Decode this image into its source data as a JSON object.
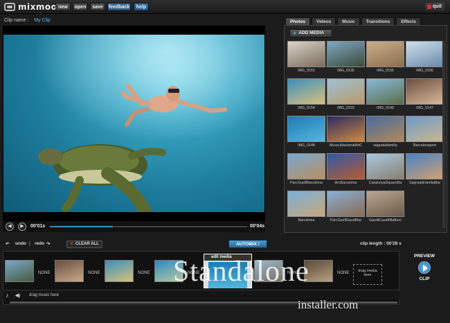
{
  "app": {
    "logo_text": "mixmoov"
  },
  "menu": {
    "new": "new",
    "open": "open",
    "save": "save",
    "feedback": "feedback",
    "help": "help",
    "quit": "quit"
  },
  "clip": {
    "label": "Clip name :",
    "name": "My Clip"
  },
  "player": {
    "current_time": "00'01s",
    "total_time": "00'04s",
    "progress": 0.32
  },
  "media_tabs": [
    "Photos",
    "Videos",
    "Music",
    "Transitions",
    "Effects"
  ],
  "add_media_label": "ADD MEDIA",
  "media": [
    {
      "label": "IMG_0151",
      "colors": [
        "#d9d3c8",
        "#7a6c5a"
      ]
    },
    {
      "label": "IMG_0135",
      "colors": [
        "#7fa7c4",
        "#3d4a3a"
      ]
    },
    {
      "label": "IMG_0155",
      "colors": [
        "#c9b08a",
        "#8a6d4e"
      ]
    },
    {
      "label": "IMG_0156",
      "colors": [
        "#cde0ee",
        "#6a8aa6"
      ]
    },
    {
      "label": "IMG_0154",
      "colors": [
        "#3a8fbf",
        "#d8c07a"
      ]
    },
    {
      "label": "IMG_0153",
      "colors": [
        "#9fc0d4",
        "#b89a6c"
      ]
    },
    {
      "label": "IMG_0149",
      "colors": [
        "#8ab8dc",
        "#5a6e48"
      ]
    },
    {
      "label": "IMG_0147",
      "colors": [
        "#6a5040",
        "#d9b898"
      ]
    },
    {
      "label": "IMG_0148",
      "colors": [
        "#1f7ab0",
        "#52b8e0"
      ]
    },
    {
      "label": "MuseuNacionalArtC",
      "colors": [
        "#2a2a60",
        "#d08a40"
      ]
    },
    {
      "label": "sagradafamilia",
      "colors": [
        "#4a6aa0",
        "#b08a5a"
      ]
    },
    {
      "label": "Barcelonaport",
      "colors": [
        "#6f9ac8",
        "#c8b890"
      ]
    },
    {
      "label": "ParcGuellBarcelona",
      "colors": [
        "#78a8d0",
        "#b89060"
      ]
    },
    {
      "label": "ArcBarcelona",
      "colors": [
        "#2d5aa8",
        "#b85a30"
      ]
    },
    {
      "label": "CatalunyaSquareBa",
      "colors": [
        "#a8c8e0",
        "#8a8070"
      ]
    },
    {
      "label": "SagradaFamiliaBar",
      "colors": [
        "#4a82c8",
        "#d0a070"
      ]
    },
    {
      "label": "Barcelona",
      "colors": [
        "#7ab0d8",
        "#c8a878"
      ]
    },
    {
      "label": "ParcGuellGaudiBar",
      "colors": [
        "#88b0d8",
        "#8a6a50"
      ]
    },
    {
      "label": "GaudiCasaMilaBarc",
      "colors": [
        "#b8a890",
        "#6a5a48"
      ]
    }
  ],
  "timeline": {
    "undo": "undo",
    "redo": "redo",
    "clear_all": "CLEAR ALL",
    "automix": "AUTOMIX !",
    "clip_length": "clip length : 00'28 s",
    "none_label": "NONE",
    "edit_media": "edit media",
    "drag_media": "drag media here",
    "drag_music": "drag music here",
    "clips": [
      {
        "colors": [
          "#7aa8c8",
          "#4a5a40"
        ]
      },
      {
        "colors": [
          "#6a5040",
          "#c8a888"
        ]
      },
      {
        "colors": [
          "#3a8fbf",
          "#d8c07a"
        ]
      },
      {
        "colors": [
          "#2a8ac0",
          "#b8c8a0"
        ]
      },
      {
        "colors": [
          "#1f7ab0",
          "#52b8e0"
        ]
      },
      {
        "colors": [
          "#9ab8d0",
          "#7a7060"
        ]
      },
      {
        "colors": [
          "#5a4a3a",
          "#b8a080"
        ]
      }
    ]
  },
  "preview": {
    "top": "PREVIEW",
    "bottom": "CLIP"
  },
  "watermark": {
    "main": "Standalone",
    "sub": "installer.com"
  }
}
